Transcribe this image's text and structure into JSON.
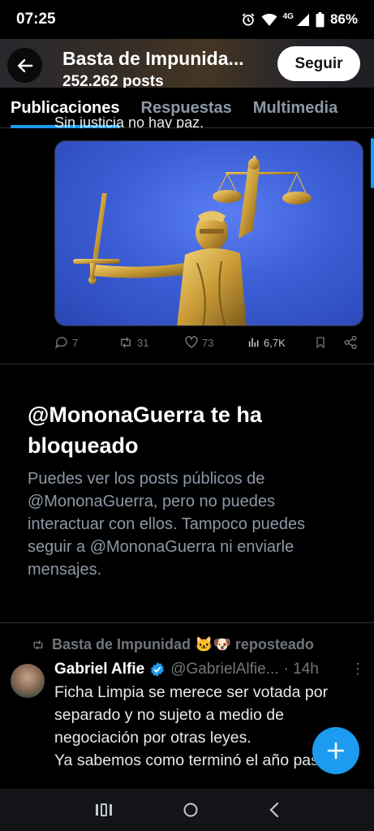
{
  "status_bar": {
    "time": "07:25",
    "network": "4G",
    "battery": "86%"
  },
  "header": {
    "title": "Basta de Impunida...",
    "subtitle": "252.262 posts",
    "follow_label": "Seguir"
  },
  "tabs": [
    {
      "label": "Publicaciones",
      "active": true
    },
    {
      "label": "Respuestas",
      "active": false
    },
    {
      "label": "Multimedia",
      "active": false
    }
  ],
  "first_post": {
    "clipped_text": "Sin justicia no hay paz.",
    "actions": {
      "replies": "7",
      "reposts": "31",
      "likes": "73",
      "views": "6,7K"
    }
  },
  "blocked_notice": {
    "title": "@MononaGuerra te ha bloqueado",
    "description": "Puedes ver los posts públicos de @MononaGuerra, pero no puedes interactuar con ellos. Tampoco puedes seguir a @MononaGuerra ni enviarle mensajes."
  },
  "second_post": {
    "repost_by": "Basta de Impunidad 🐱🐶 reposteado",
    "author_name": "Gabriel Alfie",
    "author_handle": "@GabrielAlfie...",
    "time": "· 14h",
    "text": "Ficha Limpia se merece ser votada por separado y no sujeto a medio de negociación por otras leyes.\nYa sabemos como terminó el año pasado."
  },
  "colors": {
    "accent": "#1d9bf0",
    "background": "#000000",
    "muted_text": "#71767b",
    "verified": "#1d9bf0"
  },
  "icons": {
    "back": "arrow-left-icon",
    "reply": "speech-bubble-icon",
    "repost": "repost-arrows-icon",
    "like": "heart-icon",
    "views": "bar-chart-icon",
    "bookmark": "bookmark-icon",
    "share": "share-icon",
    "compose": "plus-icon",
    "verified": "verified-badge-icon"
  }
}
